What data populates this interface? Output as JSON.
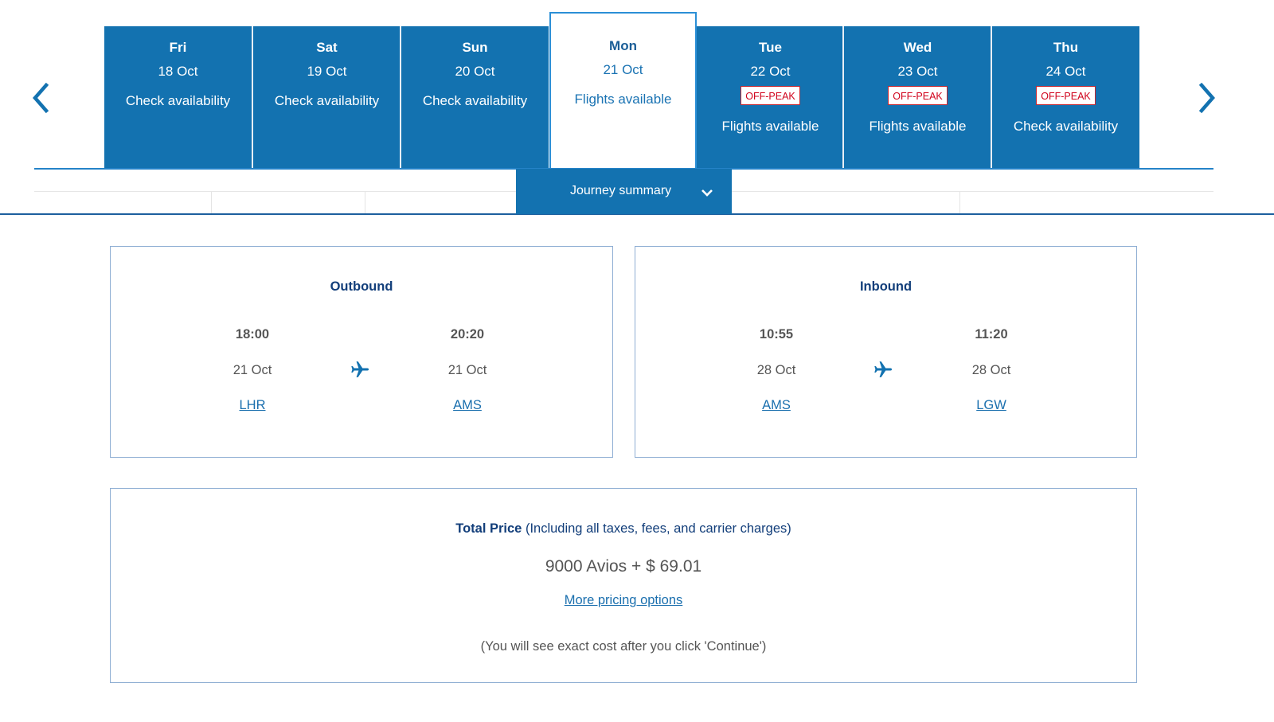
{
  "colors": {
    "tile_blue": "#1372b0",
    "selected_border": "#2b8fd6",
    "heading_navy": "#123e7a",
    "link_blue": "#1a6fae",
    "offpeak_red": "#d0021b",
    "text_gray": "#555555"
  },
  "calendar": {
    "prev_icon": "chevron-left-icon",
    "next_icon": "chevron-right-icon",
    "days": [
      {
        "day": "Fri",
        "date": "18 Oct",
        "badge": null,
        "status": "Check availability",
        "selected": false
      },
      {
        "day": "Sat",
        "date": "19 Oct",
        "badge": null,
        "status": "Check availability",
        "selected": false
      },
      {
        "day": "Sun",
        "date": "20 Oct",
        "badge": null,
        "status": "Check availability",
        "selected": false
      },
      {
        "day": "Mon",
        "date": "21 Oct",
        "badge": null,
        "status": "Flights available",
        "selected": true
      },
      {
        "day": "Tue",
        "date": "22 Oct",
        "badge": "OFF-PEAK",
        "status": "Flights available",
        "selected": false
      },
      {
        "day": "Wed",
        "date": "23 Oct",
        "badge": "OFF-PEAK",
        "status": "Flights available",
        "selected": false
      },
      {
        "day": "Thu",
        "date": "24 Oct",
        "badge": "OFF-PEAK",
        "status": "Check availability",
        "selected": false
      }
    ]
  },
  "journey_tab": {
    "label": "Journey summary",
    "icon": "chevron-down-icon"
  },
  "outbound": {
    "title": "Outbound",
    "depart": {
      "time": "18:00",
      "date": "21 Oct",
      "airport": "LHR"
    },
    "arrive": {
      "time": "20:20",
      "date": "21 Oct",
      "airport": "AMS"
    },
    "icon": "airplane-icon"
  },
  "inbound": {
    "title": "Inbound",
    "depart": {
      "time": "10:55",
      "date": "28 Oct",
      "airport": "AMS"
    },
    "arrive": {
      "time": "11:20",
      "date": "28 Oct",
      "airport": "LGW"
    },
    "icon": "airplane-icon"
  },
  "price": {
    "title_bold": "Total Price",
    "title_rest": " (Including all taxes, fees, and carrier charges)",
    "amount": "9000 Avios + $ 69.01",
    "more_options_link": "More pricing options",
    "note": "(You will see exact cost after you click 'Continue')"
  }
}
